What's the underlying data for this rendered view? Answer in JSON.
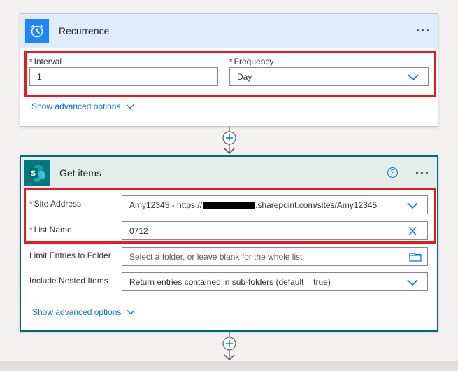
{
  "recurrence": {
    "title": "Recurrence",
    "more_label": "···",
    "interval": {
      "label": "Interval",
      "required_mark": "*",
      "value": "1"
    },
    "frequency": {
      "label": "Frequency",
      "required_mark": "*",
      "value": "Day"
    },
    "advanced_label": "Show advanced options"
  },
  "get_items": {
    "title": "Get items",
    "more_label": "···",
    "help_label": "?",
    "site_address": {
      "label": "Site Address",
      "required_mark": "*",
      "value_prefix": "Amy12345 - https://",
      "value_suffix": ".sharepoint.com/sites/Amy12345"
    },
    "list_name": {
      "label": "List Name",
      "required_mark": "*",
      "value": "0712"
    },
    "limit_folder": {
      "label": "Limit Entries to Folder",
      "placeholder": "Select a folder, or leave blank for the whole list"
    },
    "nested_items": {
      "label": "Include Nested Items",
      "value": "Return entries contained in sub-folders (default = true)"
    },
    "advanced_label": "Show advanced options"
  },
  "connectors": {
    "add_label": "+"
  },
  "colors": {
    "recurrence_header": "#deecfc",
    "recurrence_icon": "#1f85ff",
    "sharepoint_header": "#e3eeeb",
    "sharepoint_border": "#036c70",
    "sharepoint_icon": "#03787c",
    "highlight": "#e31b23",
    "link": "#0078d4"
  }
}
